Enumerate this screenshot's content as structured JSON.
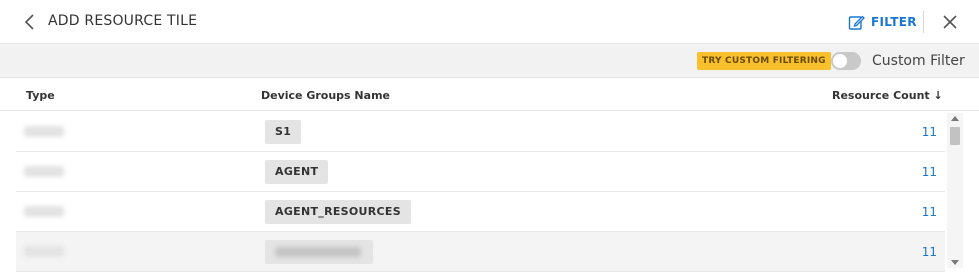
{
  "header": {
    "title": "ADD RESOURCE TILE",
    "filter_label": "FILTER"
  },
  "toolbar": {
    "try_badge": "TRY CUSTOM FILTERING",
    "custom_filter_label": "Custom Filter",
    "custom_filter_enabled": false
  },
  "table": {
    "columns": {
      "type": "Type",
      "name": "Device Groups Name",
      "count": "Resource Count ↓"
    },
    "rows": [
      {
        "name": "S1",
        "count": "11"
      },
      {
        "name": "AGENT",
        "count": "11"
      },
      {
        "name": "AGENT_RESOURCES",
        "count": "11"
      },
      {
        "name": "",
        "count": "11"
      }
    ]
  },
  "colors": {
    "accent": "#1976d2",
    "badge": "#f7c02c"
  }
}
